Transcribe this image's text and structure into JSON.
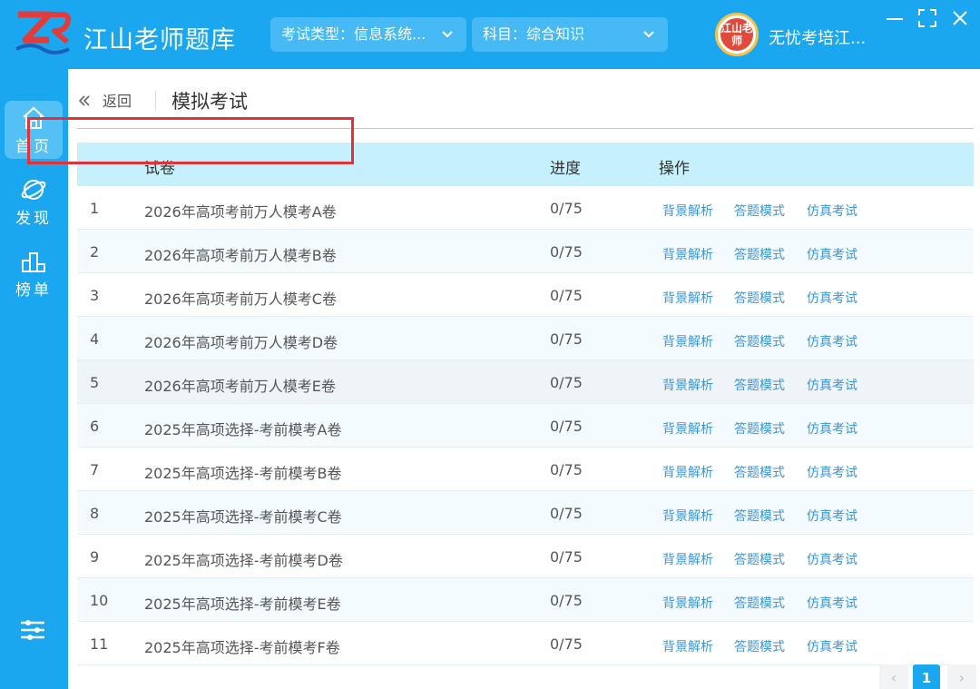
{
  "app": {
    "title": "江山老师题库",
    "exam_select": "考试类型：信息系统...",
    "subject_select": "科目：综合知识",
    "avatar_text": "江山老师",
    "username": "无忧考培江..."
  },
  "sidebar": {
    "items": [
      {
        "label": "首页",
        "icon": "home-icon",
        "active": true
      },
      {
        "label": "发现",
        "icon": "discover-icon",
        "active": false
      },
      {
        "label": "榜单",
        "icon": "ranking-icon",
        "active": false
      }
    ]
  },
  "breadcrumb": {
    "back_label": "返回",
    "page_title": "模拟考试"
  },
  "table": {
    "headers": [
      "试卷",
      "进度",
      "操作"
    ],
    "actions": [
      "背景解析",
      "答题模式",
      "仿真考试"
    ],
    "rows": [
      {
        "idx": "1",
        "name": "2026年高项考前万人模考A卷",
        "progress": "0/75"
      },
      {
        "idx": "2",
        "name": "2026年高项考前万人模考B卷",
        "progress": "0/75"
      },
      {
        "idx": "3",
        "name": "2026年高项考前万人模考C卷",
        "progress": "0/75"
      },
      {
        "idx": "4",
        "name": "2026年高项考前万人模考D卷",
        "progress": "0/75"
      },
      {
        "idx": "5",
        "name": "2026年高项考前万人模考E卷",
        "progress": "0/75"
      },
      {
        "idx": "6",
        "name": "2025年高项选择-考前模考A卷",
        "progress": "0/75"
      },
      {
        "idx": "7",
        "name": "2025年高项选择-考前模考B卷",
        "progress": "0/75"
      },
      {
        "idx": "8",
        "name": "2025年高项选择-考前模考C卷",
        "progress": "0/75"
      },
      {
        "idx": "9",
        "name": "2025年高项选择-考前模考D卷",
        "progress": "0/75"
      },
      {
        "idx": "10",
        "name": "2025年高项选择-考前模考E卷",
        "progress": "0/75"
      },
      {
        "idx": "11",
        "name": "2025年高项选择-考前模考F卷",
        "progress": "0/75"
      }
    ]
  },
  "pager": {
    "prev": "‹",
    "current": "1",
    "next": "›"
  },
  "colors": {
    "brand": "#1aa7f0",
    "header_row": "#c6f0fb",
    "action_link": "#3a96d8",
    "highlight": "#e0323a"
  }
}
